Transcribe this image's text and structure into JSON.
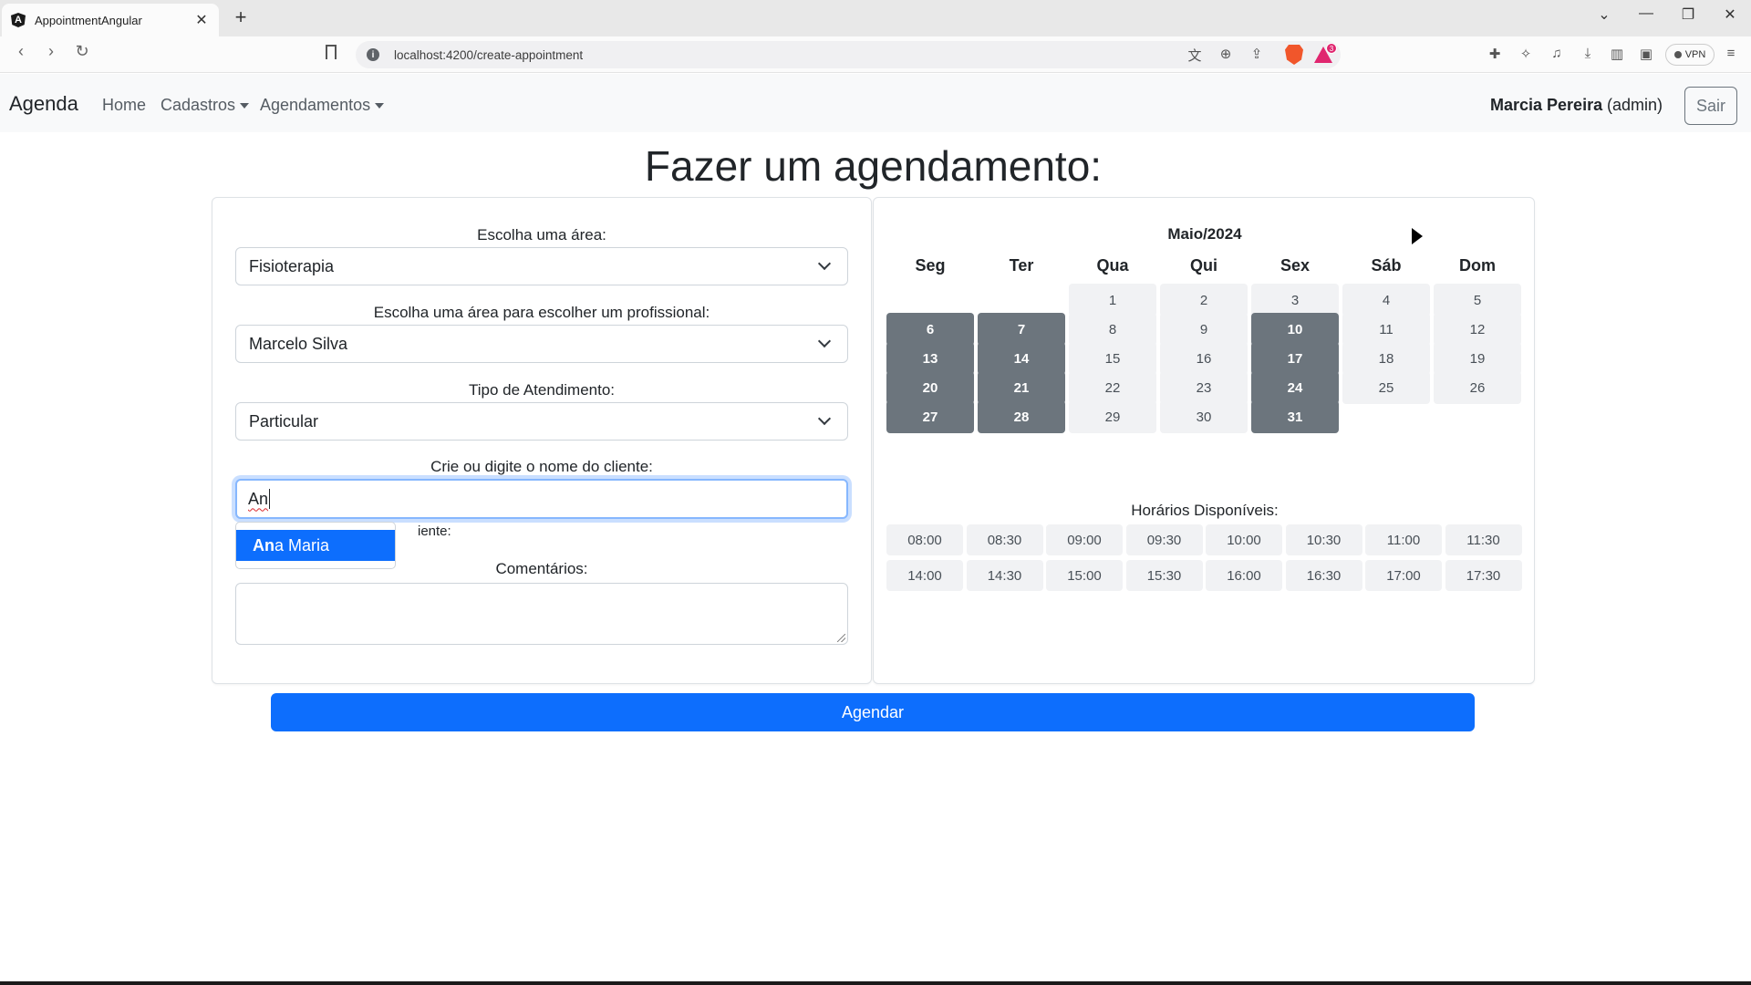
{
  "browser": {
    "tab_title": "AppointmentAngular",
    "tab_favicon": "A",
    "url": "localhost:4200/create-appointment",
    "rewards_count": "3",
    "vpn_label": "VPN",
    "icons": [
      "back-icon",
      "forward-icon",
      "reload-icon",
      "bookmark-icon",
      "info-icon",
      "translate-icon",
      "zoom-icon",
      "share-icon",
      "brave-shield-icon",
      "brave-rewards-icon",
      "extensions-icon",
      "leo-icon",
      "media-icon",
      "download-icon",
      "sidebar-icon",
      "wallet-icon",
      "menu-icon"
    ]
  },
  "navbar": {
    "brand": "Agenda",
    "links": [
      {
        "label": "Home"
      },
      {
        "label": "Cadastros"
      },
      {
        "label": "Agendamentos"
      }
    ],
    "user_name": "Marcia Pereira",
    "user_role": "(admin)",
    "logout_label": "Sair"
  },
  "page": {
    "title": "Fazer um agendamento:"
  },
  "form": {
    "area_label": "Escolha uma área:",
    "area_value": "Fisioterapia",
    "professional_label": "Escolha uma área para escolher um profissional:",
    "professional_value": "Marcelo Silva",
    "service_type_label": "Tipo de Atendimento:",
    "service_type_value": "Particular",
    "client_label": "Crie ou digite o nome do cliente:",
    "client_value": "An",
    "partial_hidden_label": "iente:",
    "suggestion": {
      "match": "An",
      "rest": "a Maria"
    },
    "comments_label": "Comentários:",
    "submit_label": "Agendar"
  },
  "calendar": {
    "title": "Maio/2024",
    "weekdays": [
      "Seg",
      "Ter",
      "Qua",
      "Qui",
      "Sex",
      "Sáb",
      "Dom"
    ],
    "first_weekday_index": 2,
    "days_in_month": 31,
    "busy_days": [
      6,
      7,
      10,
      13,
      14,
      17,
      20,
      21,
      24,
      27,
      28,
      31
    ],
    "colors": {
      "busy": "#6c757d",
      "free": "#f1f2f4",
      "accent": "#0d6efd"
    }
  },
  "slots": {
    "title": "Horários Disponíveis:",
    "times": [
      "08:00",
      "08:30",
      "09:00",
      "09:30",
      "10:00",
      "10:30",
      "11:00",
      "11:30",
      "14:00",
      "14:30",
      "15:00",
      "15:30",
      "16:00",
      "16:30",
      "17:00",
      "17:30"
    ]
  }
}
